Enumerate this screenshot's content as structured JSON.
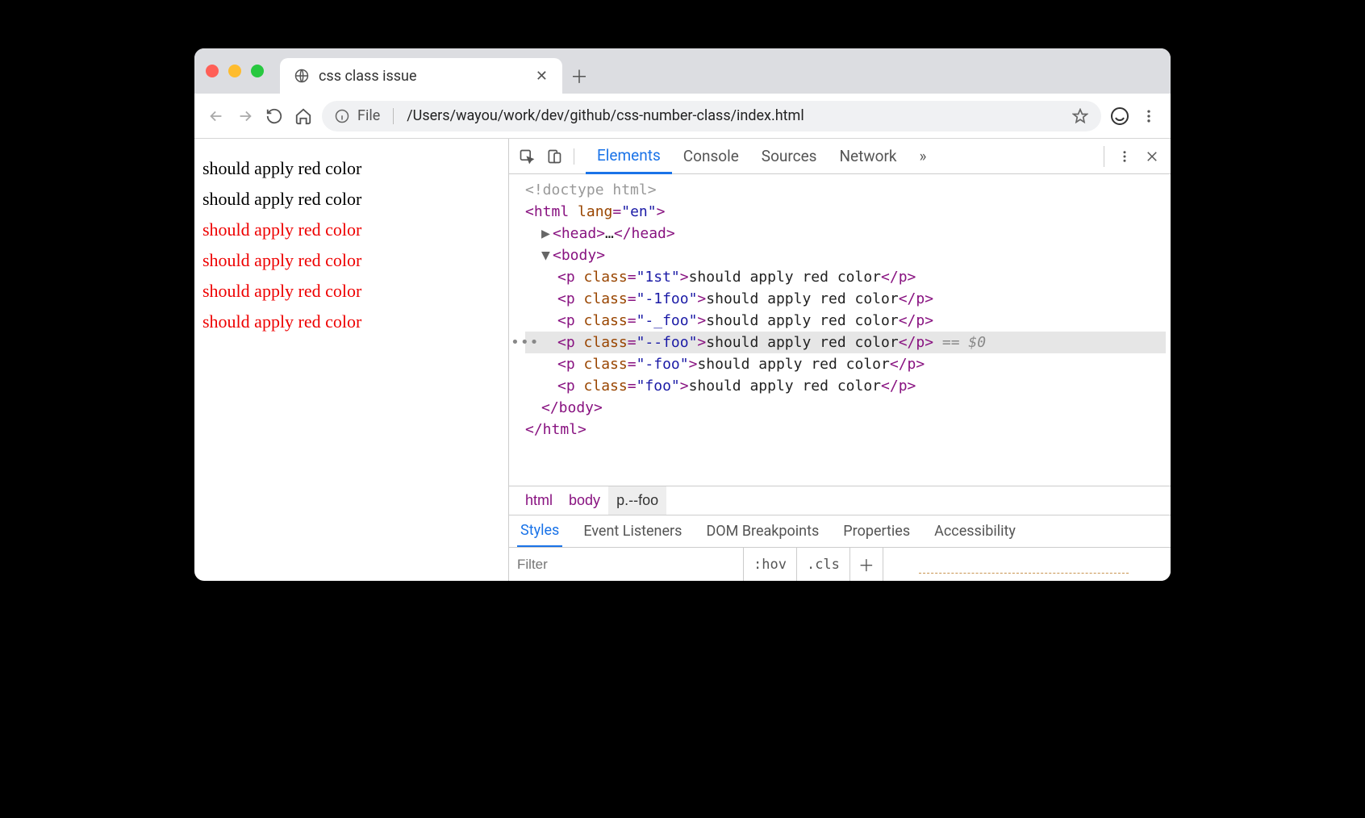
{
  "browser": {
    "tab_title": "css class issue",
    "url_scheme_label": "File",
    "url_path": "/Users/wayou/work/dev/github/css-number-class/index.html"
  },
  "page": {
    "lines": [
      {
        "text": "should apply red color",
        "red": false
      },
      {
        "text": "should apply red color",
        "red": false
      },
      {
        "text": "should apply red color",
        "red": true
      },
      {
        "text": "should apply red color",
        "red": true
      },
      {
        "text": "should apply red color",
        "red": true
      },
      {
        "text": "should apply red color",
        "red": true
      }
    ]
  },
  "devtools": {
    "panels": [
      "Elements",
      "Console",
      "Sources",
      "Network"
    ],
    "active_panel": "Elements",
    "overflow_glyph": "»",
    "dom": {
      "doctype": "<!doctype html>",
      "html_open": {
        "tag": "html",
        "attrs": [
          {
            "n": "lang",
            "v": "en"
          }
        ]
      },
      "head_collapsed": {
        "tag": "head",
        "ellipsis": "…"
      },
      "body_open": {
        "tag": "body"
      },
      "paras": [
        {
          "cls": "1st",
          "text": "should apply red color",
          "selected": false
        },
        {
          "cls": "-1foo",
          "text": "should apply red color",
          "selected": false
        },
        {
          "cls": "-_foo",
          "text": "should apply red color",
          "selected": false
        },
        {
          "cls": "--foo",
          "text": "should apply red color",
          "selected": true,
          "anno": "== $0"
        },
        {
          "cls": "-foo",
          "text": "should apply red color",
          "selected": false
        },
        {
          "cls": "foo",
          "text": "should apply red color",
          "selected": false
        }
      ]
    },
    "breadcrumb": [
      "html",
      "body",
      "p.--foo"
    ],
    "styles_tabs": [
      "Styles",
      "Event Listeners",
      "DOM Breakpoints",
      "Properties",
      "Accessibility"
    ],
    "styles_active": "Styles",
    "filter_placeholder": "Filter",
    "hov_label": ":hov",
    "cls_label": ".cls"
  }
}
